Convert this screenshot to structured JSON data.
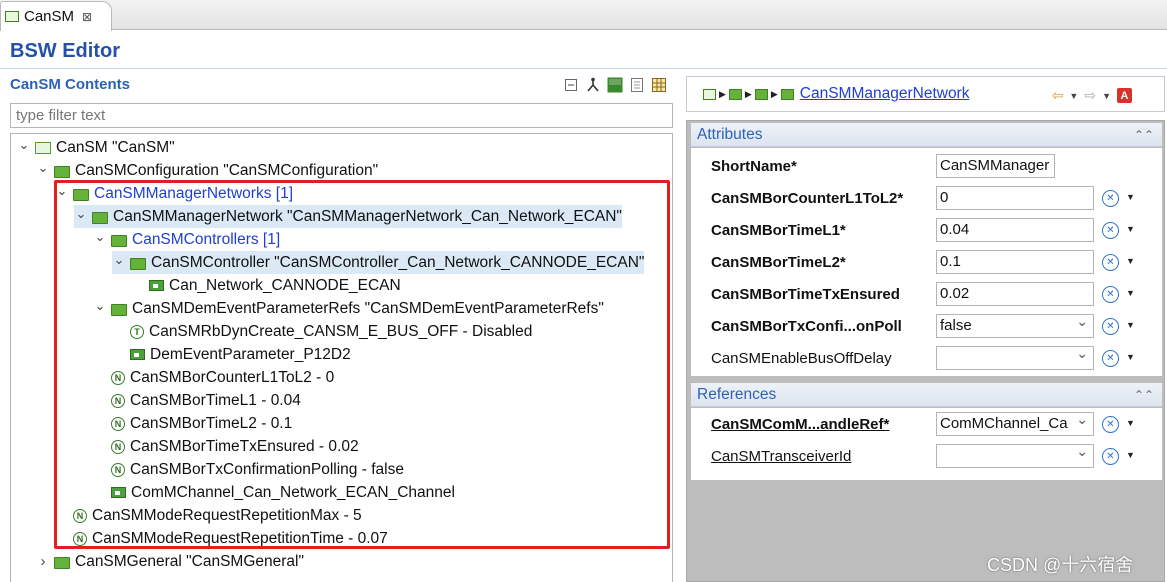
{
  "tab": {
    "label": "CanSM",
    "close": "⊠"
  },
  "editor_title": "BSW Editor",
  "left": {
    "title": "CanSM Contents",
    "filter_placeholder": "type filter text",
    "toolbar_icons": [
      "collapse-all-icon",
      "link-icon",
      "vp-res-icon",
      "page-icon",
      "grid-icon"
    ],
    "tree": [
      {
        "text": "CanSM \"CanSM\"",
        "level": 0,
        "twisty": "open",
        "icon": "root",
        "blue": false
      },
      {
        "text": "CanSMConfiguration \"CanSMConfiguration\"",
        "level": 1,
        "twisty": "open",
        "icon": "folder",
        "blue": false
      },
      {
        "text": "CanSMManagerNetworks [1]",
        "level": 2,
        "twisty": "open",
        "icon": "folder",
        "blue": true
      },
      {
        "text": "CanSMManagerNetwork \"CanSMManagerNetwork_Can_Network_ECAN\"",
        "level": 3,
        "twisty": "open",
        "icon": "folder",
        "blue": false,
        "selected": true
      },
      {
        "text": "CanSMControllers [1]",
        "level": 4,
        "twisty": "open",
        "icon": "folder",
        "blue": true
      },
      {
        "text": "CanSMController \"CanSMController_Can_Network_CANNODE_ECAN\"",
        "level": 5,
        "twisty": "open",
        "icon": "folder",
        "blue": false,
        "selected": true
      },
      {
        "text": "Can_Network_CANNODE_ECAN",
        "level": 6,
        "twisty": "",
        "icon": "ref",
        "blue": false
      },
      {
        "text": "CanSMDemEventParameterRefs \"CanSMDemEventParameterRefs\"",
        "level": 4,
        "twisty": "open",
        "icon": "folder",
        "blue": false
      },
      {
        "text": "CanSMRbDynCreate_CANSM_E_BUS_OFF - Disabled",
        "level": 5,
        "twisty": "",
        "icon": "T",
        "blue": false
      },
      {
        "text": "DemEventParameter_P12D2",
        "level": 5,
        "twisty": "",
        "icon": "ref",
        "blue": false
      },
      {
        "text": "CanSMBorCounterL1ToL2 - 0",
        "level": 4,
        "twisty": "",
        "icon": "N",
        "blue": false
      },
      {
        "text": "CanSMBorTimeL1 - 0.04",
        "level": 4,
        "twisty": "",
        "icon": "N",
        "blue": false
      },
      {
        "text": "CanSMBorTimeL2 - 0.1",
        "level": 4,
        "twisty": "",
        "icon": "N",
        "blue": false
      },
      {
        "text": "CanSMBorTimeTxEnsured - 0.02",
        "level": 4,
        "twisty": "",
        "icon": "N",
        "blue": false
      },
      {
        "text": "CanSMBorTxConfirmationPolling - false",
        "level": 4,
        "twisty": "",
        "icon": "N",
        "blue": false
      },
      {
        "text": "ComMChannel_Can_Network_ECAN_Channel",
        "level": 4,
        "twisty": "",
        "icon": "ref",
        "blue": false
      },
      {
        "text": "CanSMModeRequestRepetitionMax - 5",
        "level": 2,
        "twisty": "",
        "icon": "N",
        "blue": false
      },
      {
        "text": "CanSMModeRequestRepetitionTime - 0.07",
        "level": 2,
        "twisty": "",
        "icon": "N",
        "blue": false
      },
      {
        "text": "CanSMGeneral \"CanSMGeneral\"",
        "level": 1,
        "twisty": "closed",
        "icon": "folder",
        "blue": false
      }
    ]
  },
  "right": {
    "breadcrumb_link": "CanSMManagerNetwork",
    "attributes_title": "Attributes",
    "attributes": [
      {
        "label": "ShortName*",
        "value": "CanSMManager",
        "kind": "short",
        "style": "bold",
        "reset": false
      },
      {
        "label": "CanSMBorCounterL1ToL2*",
        "value": "0",
        "kind": "wide",
        "style": "bold",
        "reset": true
      },
      {
        "label": "CanSMBorTimeL1*",
        "value": "0.04",
        "kind": "wide",
        "style": "bold",
        "reset": true
      },
      {
        "label": "CanSMBorTimeL2*",
        "value": "0.1",
        "kind": "wide",
        "style": "bold",
        "reset": true
      },
      {
        "label": "CanSMBorTimeTxEnsured",
        "value": "0.02",
        "kind": "wide",
        "style": "bold",
        "reset": true
      },
      {
        "label": "CanSMBorTxConfi...onPoll",
        "value": "false",
        "kind": "combo",
        "style": "bold",
        "reset": true
      },
      {
        "label": "CanSMEnableBusOffDelay",
        "value": "",
        "kind": "combo",
        "style": "normal",
        "reset": true
      }
    ],
    "references_title": "References",
    "references": [
      {
        "label": "CanSMComM...andleRef*",
        "value": "ComMChannel_Ca",
        "kind": "combo",
        "style": "boldlink",
        "reset": true
      },
      {
        "label": "CanSMTransceiverId",
        "value": "",
        "kind": "combo",
        "style": "link",
        "reset": true
      }
    ]
  },
  "watermark": "CSDN @十六宿舍",
  "colors": {
    "accent": "#2c62b8",
    "highlight_box": "#e02020",
    "tree_blue": "#1e3fd0"
  }
}
